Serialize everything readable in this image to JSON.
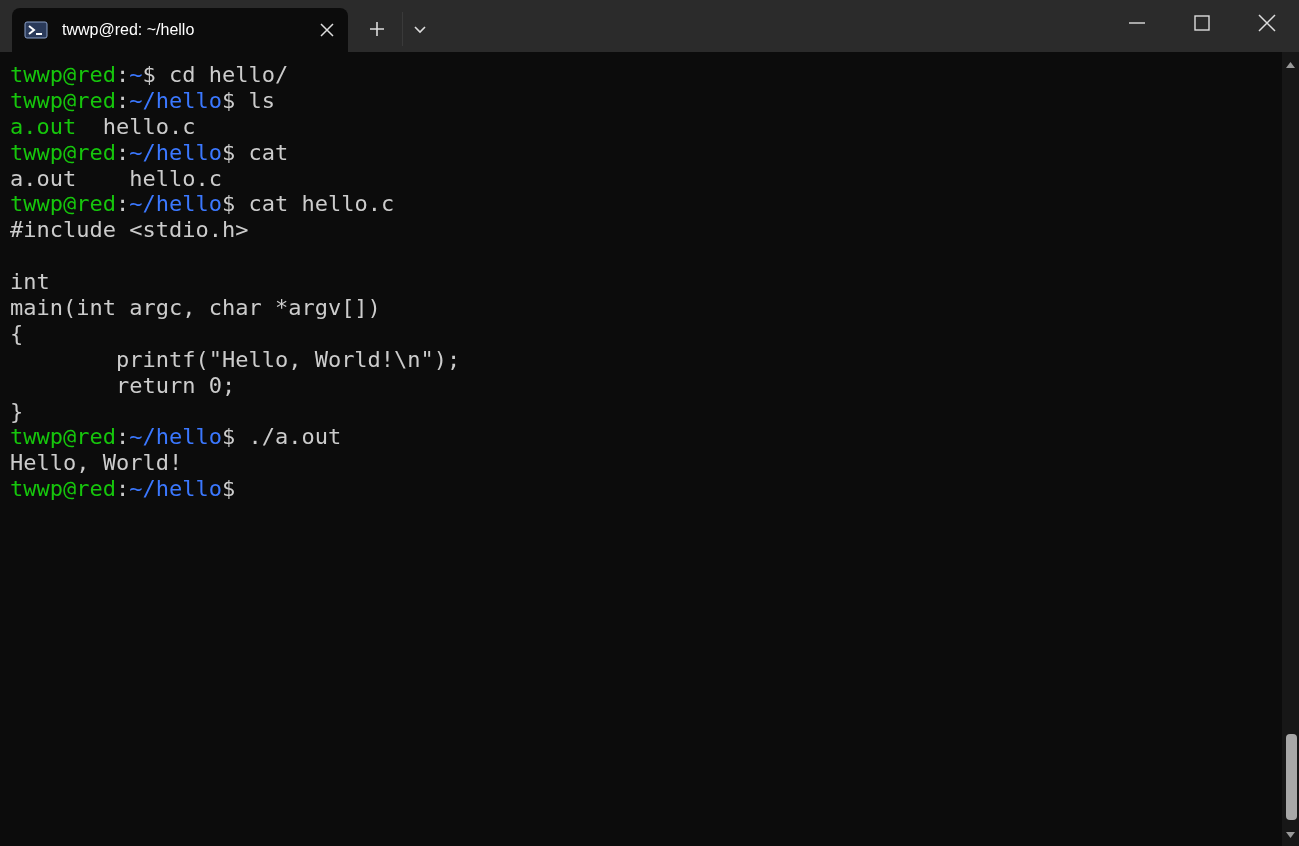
{
  "tabs": [
    {
      "label": "twwp@red: ~/hello",
      "selected": true
    }
  ],
  "terminal": {
    "lines": [
      {
        "kind": "text",
        "segments": [
          {
            "kind": "user",
            "text": "twwp@red"
          },
          {
            "kind": "plain",
            "text": ":"
          },
          {
            "kind": "path",
            "text": "~"
          },
          {
            "kind": "plain",
            "text": "$ cd hello/"
          }
        ]
      },
      {
        "kind": "text",
        "segments": [
          {
            "kind": "user",
            "text": "twwp@red"
          },
          {
            "kind": "plain",
            "text": ":"
          },
          {
            "kind": "path",
            "text": "~/hello"
          },
          {
            "kind": "plain",
            "text": "$ ls"
          }
        ]
      },
      {
        "kind": "text",
        "segments": [
          {
            "kind": "exec",
            "text": "a.out"
          },
          {
            "kind": "plain",
            "text": "  hello.c"
          }
        ]
      },
      {
        "kind": "text",
        "segments": [
          {
            "kind": "user",
            "text": "twwp@red"
          },
          {
            "kind": "plain",
            "text": ":"
          },
          {
            "kind": "path",
            "text": "~/hello"
          },
          {
            "kind": "plain",
            "text": "$ cat"
          }
        ]
      },
      {
        "kind": "text",
        "segments": [
          {
            "kind": "plain",
            "text": "a.out    hello.c"
          }
        ]
      },
      {
        "kind": "text",
        "segments": [
          {
            "kind": "user",
            "text": "twwp@red"
          },
          {
            "kind": "plain",
            "text": ":"
          },
          {
            "kind": "path",
            "text": "~/hello"
          },
          {
            "kind": "plain",
            "text": "$ cat hello.c"
          }
        ]
      },
      {
        "kind": "text",
        "segments": [
          {
            "kind": "plain",
            "text": "#include <stdio.h>"
          }
        ]
      },
      {
        "kind": "blank"
      },
      {
        "kind": "text",
        "segments": [
          {
            "kind": "plain",
            "text": "int"
          }
        ]
      },
      {
        "kind": "text",
        "segments": [
          {
            "kind": "plain",
            "text": "main(int argc, char *argv[])"
          }
        ]
      },
      {
        "kind": "text",
        "segments": [
          {
            "kind": "plain",
            "text": "{"
          }
        ]
      },
      {
        "kind": "text",
        "segments": [
          {
            "kind": "plain",
            "text": "        printf(\"Hello, World!\\n\");"
          }
        ]
      },
      {
        "kind": "text",
        "segments": [
          {
            "kind": "plain",
            "text": "        return 0;"
          }
        ]
      },
      {
        "kind": "text",
        "segments": [
          {
            "kind": "plain",
            "text": "}"
          }
        ]
      },
      {
        "kind": "text",
        "segments": [
          {
            "kind": "user",
            "text": "twwp@red"
          },
          {
            "kind": "plain",
            "text": ":"
          },
          {
            "kind": "path",
            "text": "~/hello"
          },
          {
            "kind": "plain",
            "text": "$ ./a.out"
          }
        ]
      },
      {
        "kind": "text",
        "segments": [
          {
            "kind": "plain",
            "text": "Hello, World!"
          }
        ]
      },
      {
        "kind": "text",
        "segments": [
          {
            "kind": "user",
            "text": "twwp@red"
          },
          {
            "kind": "plain",
            "text": ":"
          },
          {
            "kind": "path",
            "text": "~/hello"
          },
          {
            "kind": "plain",
            "text": "$"
          }
        ]
      }
    ]
  }
}
